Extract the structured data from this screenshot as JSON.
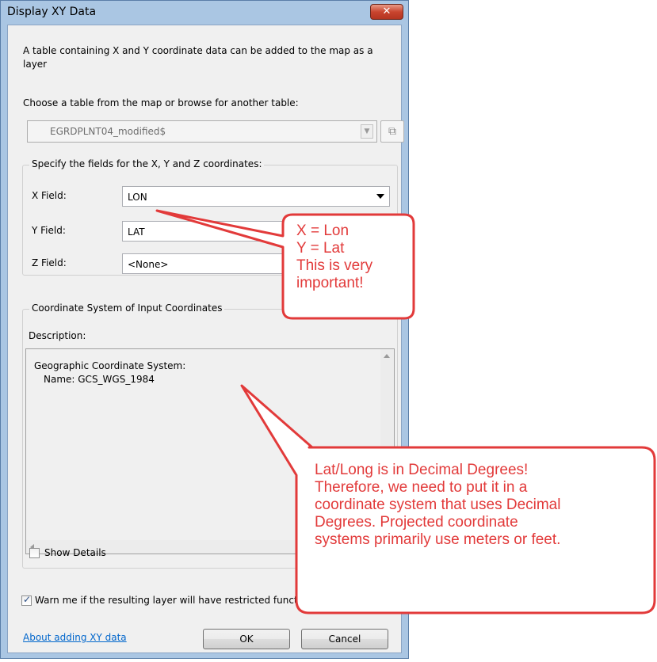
{
  "dialog": {
    "title": "Display XY Data",
    "close_glyph": "✕",
    "intro_text": "A table containing X and Y coordinate data can be added to the map as a layer",
    "choose_label": "Choose a table from the map or browse for another table:",
    "table_value": "EGRDPLNT04_modified$",
    "fields_group_title": "Specify the fields for the X, Y and Z coordinates:",
    "x_label": "X Field:",
    "x_value": "LON",
    "y_label": "Y Field:",
    "y_value": "LAT",
    "z_label": "Z Field:",
    "z_value": "<None>",
    "coord_group_title": "Coordinate System of Input Coordinates",
    "description_label": "Description:",
    "description_line1": "Geographic Coordinate System:",
    "description_line2": "Name: GCS_WGS_1984",
    "show_details_label": "Show Details",
    "warn_label": "Warn me if the resulting layer will have restricted functionality",
    "about_link": "About adding XY data",
    "ok_label": "OK",
    "cancel_label": "Cancel"
  },
  "callout1": {
    "lines": [
      "X = Lon",
      "Y = Lat",
      "This is very",
      "important!"
    ]
  },
  "callout2": {
    "lines": [
      "Lat/Long is in Decimal Degrees!",
      "Therefore, we need to put it in a",
      "coordinate system that uses Decimal",
      "Degrees. Projected coordinate",
      "systems primarily use meters or feet."
    ]
  },
  "colors": {
    "callout_stroke": "#e23a3a",
    "callout_text": "#e23a3a",
    "link": "#0066cc",
    "frame": "#aac6e3"
  }
}
